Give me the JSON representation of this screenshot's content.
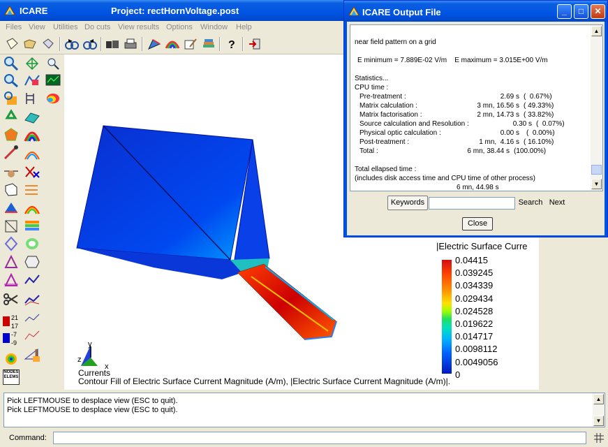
{
  "window": {
    "app_title": "ICARE",
    "project_title": "Project: rectHornVoltage.post"
  },
  "menu": [
    "Files",
    "View",
    "Utilities",
    "Do cuts",
    "View results",
    "Options",
    "Window",
    "Help"
  ],
  "toolbar": {
    "icons": [
      "new-file-icon",
      "open-folder-icon",
      "save-disk-icon",
      "rotate-left-icon",
      "rotate-right-icon",
      "camera-icon",
      "print-icon",
      "draw-tool-icon",
      "palette-icon",
      "edit-icon",
      "layers-icon",
      "help-icon",
      "exit-icon"
    ]
  },
  "sidebar": {
    "legend_numbers": [
      "21",
      "17",
      "-7",
      "-9"
    ],
    "nodes_elems_label": "NODES ELEMS"
  },
  "canvas": {
    "legend_title": "|Electric Surface Curre",
    "legend_values": [
      "0.04415",
      "0.039245",
      "0.034339",
      "0.029434",
      "0.024528",
      "0.019622",
      "0.014717",
      "0.0098112",
      "0.0049056",
      "0"
    ],
    "axis_labels": {
      "x": "x",
      "y": "y",
      "z": "z"
    },
    "currents_label": "Currents",
    "caption": "Contour Fill of Electric Surface Current Magnitude (A/m), |Electric Surface Current Magnitude (A/m)|."
  },
  "console": {
    "lines": [
      "Pick LEFTMOUSE to desplace view (ESC to quit).",
      "Pick LEFTMOUSE to desplace view (ESC to quit)."
    ]
  },
  "command": {
    "label": "Command:",
    "value": ""
  },
  "output_dialog": {
    "title": "ICARE Output File",
    "near_field": "near field pattern on a grid",
    "e_min_max": "E minimum = 7.889E-02 V/m    E maximum = 3.015E+00 V/m",
    "statistics": "Statistics...",
    "cpu_time": "CPU time :",
    "rows": [
      {
        "label": "Pre-treatment :",
        "time": "2.69 s",
        "pct": "(  0.67%)"
      },
      {
        "label": "Matrix calculation :",
        "time": "3 mn, 16.56 s",
        "pct": "( 49.33%)"
      },
      {
        "label": "Matrix factorisation :",
        "time": "2 mn, 14.73 s",
        "pct": "( 33.82%)"
      },
      {
        "label": "Source calculation and Resolution :",
        "time": "0.30 s",
        "pct": "(  0.07%)"
      },
      {
        "label": "Physical optic calculation :",
        "time": "0.00 s",
        "pct": "(  0.00%)"
      },
      {
        "label": "Post-treatment :",
        "time": "1 mn,  4.16 s",
        "pct": "( 16.10%)"
      },
      {
        "label": "Total :",
        "time": "6 mn, 38.44 s",
        "pct": "(100.00%)"
      }
    ],
    "total_elapsed": "Total ellapsed time :",
    "includes": "(includes disk access time and CPU time of other process)",
    "elapsed_value": "6 mn, 44.98 s",
    "keywords_label": "Keywords",
    "keywords_value": "",
    "search_label": "Search",
    "next_label": "Next",
    "close_label": "Close"
  },
  "colors": {
    "titlebar": "#0054e3",
    "workspace": "#ece9d8",
    "canvas": "#ffffff"
  }
}
